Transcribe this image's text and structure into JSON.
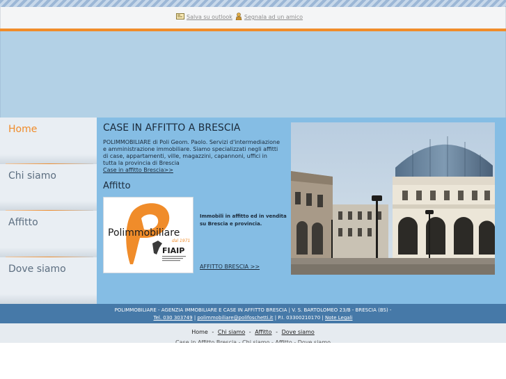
{
  "toolbar": {
    "save_outlook": "Salva su outlook",
    "send_friend": "Segnala ad un amico"
  },
  "nav": {
    "items": [
      {
        "label": "Home"
      },
      {
        "label": "Chi siamo"
      },
      {
        "label": "Affitto"
      },
      {
        "label": "Dove siamo"
      }
    ]
  },
  "main": {
    "title": "CASE IN AFFITTO A BRESCIA",
    "description": "POLIMMOBILIARE di Poli Geom. Paolo. Servizi d'intermediazione e amministrazione immobiliare. Siamo specializzati negli affitti di case, appartamenti, ville, magazzini, capannoni, uffici in tutta la provincia di Brescia",
    "description_link": "Case in affitto Brescia>>",
    "subtitle": "Affitto",
    "logo_name": "Polimmobiliare",
    "logo_since": "dal 1971",
    "logo_badge": "FIAIP",
    "promo_text": "Immobili in affitto ed in vendita su Brescia e provincia.",
    "promo_link": "AFFITTO BRESCIA >>"
  },
  "footer": {
    "line1": "POLIMMOBILIARE - AGENZIA IMMOBILIARE E CASE IN AFFITTO BRESCIA | V. S. BARTOLOMEO 23/B - BRESCIA (BS) -",
    "tel": "Tel. 030 303749",
    "sep1": " | ",
    "email": "polimmobiliare@polifoschetti.it",
    "piva": " | P.I. 03300210170 | ",
    "legal": "Note Legali"
  },
  "bottom_nav": {
    "home": "Home",
    "chi_siamo": "Chi siamo",
    "affitto": "Affitto",
    "dove_siamo": "Dove siamo",
    "dash": "-",
    "cut_line": "Case in Affitto Brescia - Chi siamo - Affitto - Dove siamo"
  },
  "colors": {
    "accent": "#f08c2a",
    "content_bg": "#85bde4",
    "footer_bg": "#4679a8"
  }
}
